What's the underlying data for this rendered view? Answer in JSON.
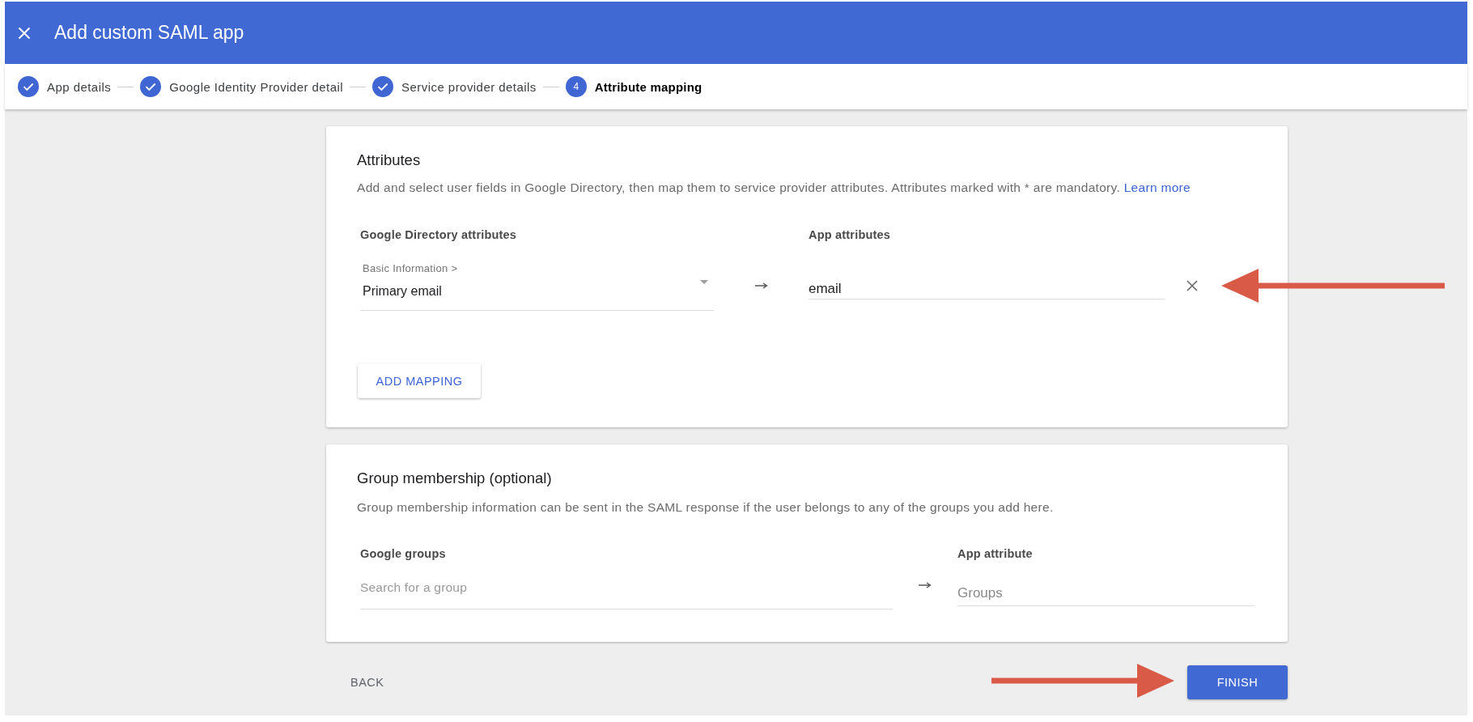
{
  "window": {
    "title": "Add custom SAML app"
  },
  "steps": [
    {
      "label": "App details",
      "completed": true,
      "selected": false
    },
    {
      "label": "Google Identity Provider detail",
      "completed": true,
      "selected": false
    },
    {
      "label": "Service provider details",
      "completed": true,
      "selected": false
    },
    {
      "label": "Attribute mapping",
      "completed": false,
      "selected": true,
      "number": "4"
    }
  ],
  "attributes": {
    "title": "Attributes",
    "description": "Add and select user fields in Google Directory, then map them to service provider attributes. Attributes marked with * are mandatory.",
    "link": "Learn more",
    "columns": [
      "Google Directory attributes",
      "App attributes"
    ],
    "mappings": [
      {
        "category": "Basic Information >",
        "value": "Primary email",
        "app_attribute": "email"
      }
    ],
    "add_button": "ADD MAPPING"
  },
  "group_membership": {
    "title": "Group membership (optional)",
    "description": "Group membership information can be sent in the SAML response if the user belongs to any of the groups you add here.",
    "columns": [
      "Google groups",
      "App attribute"
    ],
    "group_field": {
      "placeholder": "Search for a group"
    },
    "attribute_field": {
      "placeholder": "Groups"
    }
  },
  "footer": {
    "buttons": [
      {
        "label": "BACK",
        "kind": "text"
      },
      {
        "label": "FINISH",
        "kind": "primary"
      }
    ]
  }
}
